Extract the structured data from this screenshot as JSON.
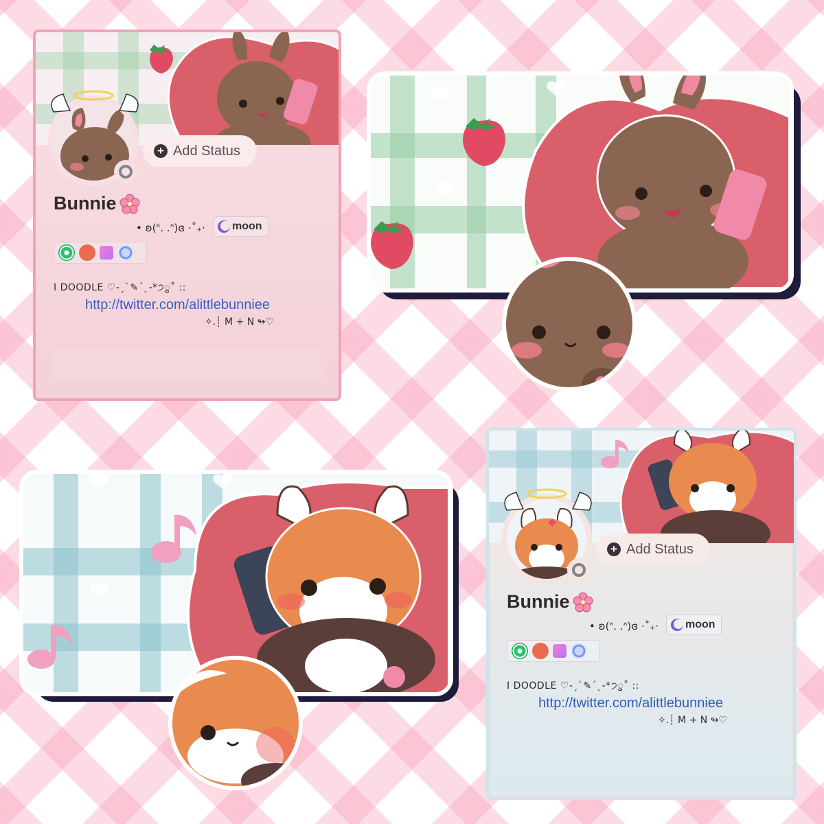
{
  "cards": [
    {
      "id": "pink",
      "add_status": "Add Status",
      "display_name": "Bunnie",
      "pronouns": "• ʚ(ᐢ. .ᐢ)ɞ ⋅˚₊‧",
      "server_tag": "moon",
      "bio_line1": "I DOODLE ♡-ˏˋ✎ˊˎ-*੭ु˚ ::",
      "bio_link": "http://twitter.com/alittlebunniee",
      "bio_line3": "✧.┊ M + N ↬♡"
    },
    {
      "id": "blue",
      "add_status": "Add Status",
      "display_name": "Bunnie",
      "pronouns": "• ʚ(ᐢ. .ᐢ)ɞ ⋅˚₊‧",
      "server_tag": "moon",
      "bio_line1": "I DOODLE ♡-ˏˋ✎ˊˎ-*੭ु˚ ::",
      "bio_link": "http://twitter.com/alittlebunniee",
      "bio_line3": "✧.┊ M + N ↬♡"
    }
  ],
  "colors": {
    "pink_border": "#f0a3b4",
    "blue_border": "#cfe4ea",
    "link": "#3b5fc0",
    "status_offline": "#80848e"
  },
  "icons": [
    "add-status-icon",
    "sakura-flower-icon",
    "moon-icon",
    "badge-nitro-icon",
    "badge-quest-icon",
    "badge-hypesquad-icon",
    "badge-boost-icon",
    "status-offline-icon",
    "strawberry-icon",
    "music-note-icon",
    "heart-icon",
    "halo-icon",
    "wings-icon"
  ]
}
